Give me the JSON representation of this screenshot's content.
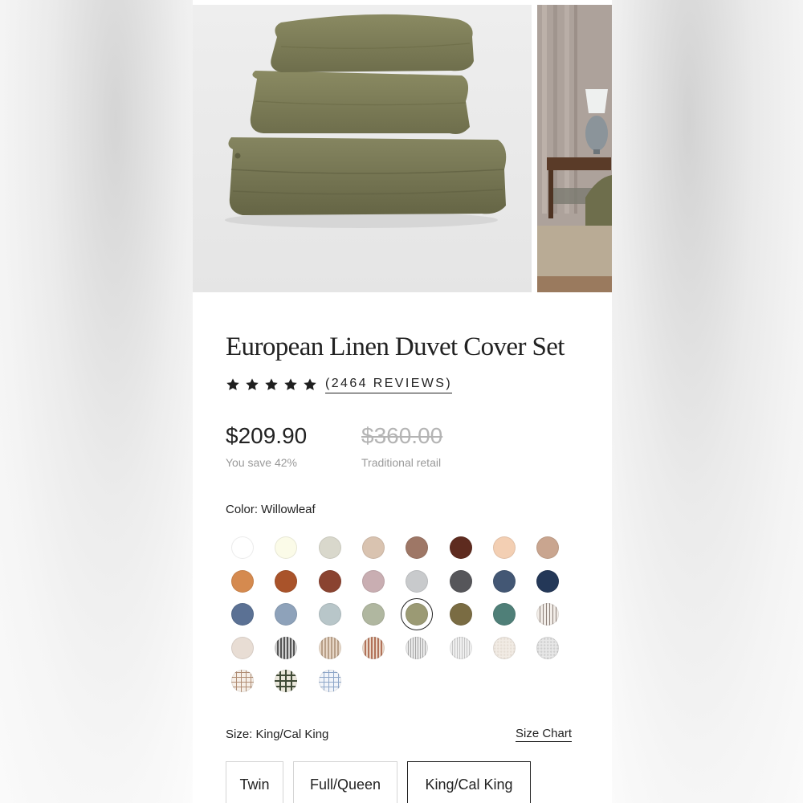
{
  "product": {
    "title": "European Linen Duvet Cover Set",
    "rating_stars": 5,
    "reviews_text": "(2464 REVIEWS)",
    "price": "$209.90",
    "savings": "You save 42%",
    "original_price": "$360.00",
    "original_price_note": "Traditional retail"
  },
  "color_selector": {
    "label": "Color: Willowleaf",
    "selected_index": 20,
    "swatches": [
      "#ffffff",
      "#fbfbe8",
      "#d9d8cc",
      "#d9c3b0",
      "#9e7766",
      "#5e2b1f",
      "#f3cfb3",
      "#c9a58f",
      "#d58a4f",
      "#a9532a",
      "#8a4330",
      "#c9aeb2",
      "#c8cacc",
      "#56565a",
      "#435774",
      "#243858",
      "#5b7194",
      "#8ea2ba",
      "#b8c6c9",
      "#b0b7a0",
      "#9b9a74",
      "#7a6c43",
      "#4f7f78",
      "pattern:stripe-v",
      "#e8ddd4",
      "pattern:stripe-v-dark",
      "pattern:stripe-v-tan",
      "pattern:stripe-v-rust",
      "pattern:stripe-v-grey",
      "pattern:stripe-v-lgrey",
      "pattern:speck-cream",
      "pattern:speck-grey",
      "pattern:check-tan",
      "pattern:check-dark",
      "pattern:check-blue"
    ]
  },
  "size_selector": {
    "label": "Size: King/Cal King",
    "chart_link": "Size Chart",
    "options": [
      "Twin",
      "Full/Queen",
      "King/Cal King"
    ],
    "selected": "King/Cal King"
  }
}
